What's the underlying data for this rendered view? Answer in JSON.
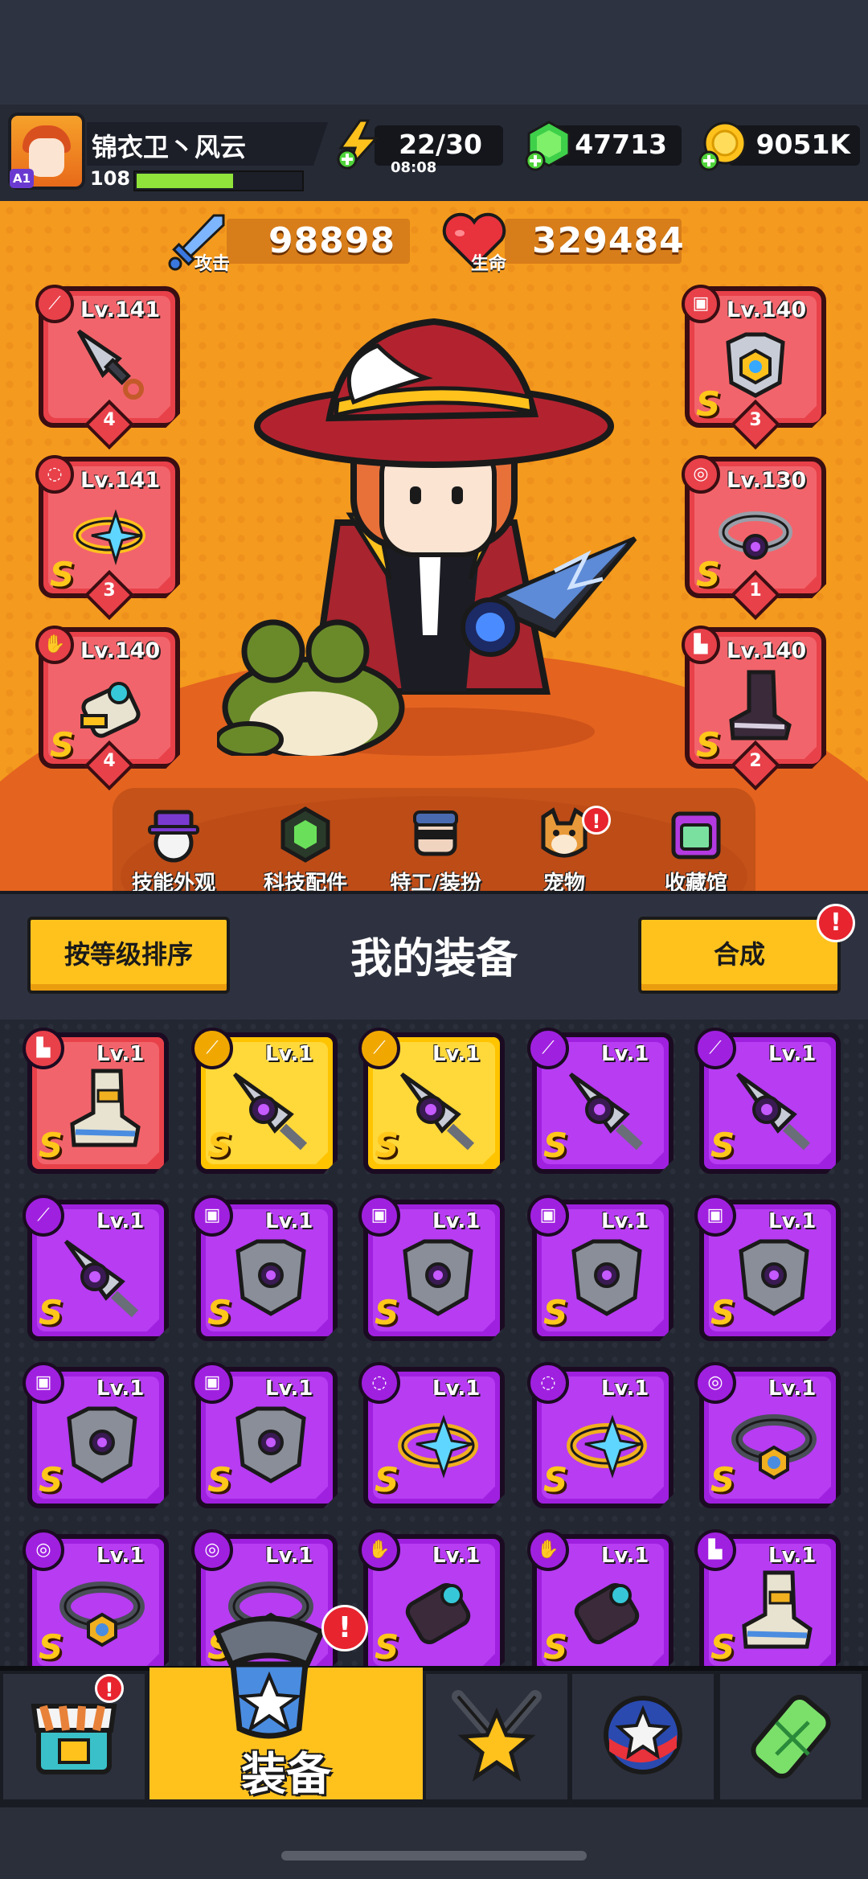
{
  "player": {
    "name": "锦衣卫丶风云",
    "level": "108",
    "rank_badge": "A1",
    "xp_progress": 0.6
  },
  "resources": {
    "energy": "22/30",
    "energy_timer": "08:08",
    "gems": "47713",
    "gold": "9051K"
  },
  "stats": {
    "attack_label": "攻击",
    "attack_value": "98898",
    "hp_label": "生命",
    "hp_value": "329484"
  },
  "equipped": {
    "left": [
      {
        "level": "Lv.141",
        "slot": "weapon",
        "grade": "",
        "stars": "4"
      },
      {
        "level": "Lv.141",
        "slot": "ring",
        "grade": "S",
        "stars": "3"
      },
      {
        "level": "Lv.140",
        "slot": "gloves",
        "grade": "S",
        "stars": "4"
      }
    ],
    "right": [
      {
        "level": "Lv.140",
        "slot": "armor",
        "grade": "S",
        "stars": "3"
      },
      {
        "level": "Lv.130",
        "slot": "belt",
        "grade": "S",
        "stars": "1"
      },
      {
        "level": "Lv.140",
        "slot": "boots",
        "grade": "S",
        "stars": "2"
      }
    ]
  },
  "subnav": [
    {
      "label": "技能外观",
      "icon": "skill-skin-icon"
    },
    {
      "label": "科技配件",
      "icon": "tech-parts-icon"
    },
    {
      "label": "特工/装扮",
      "icon": "agent-outfit-icon"
    },
    {
      "label": "宠物",
      "icon": "pet-icon",
      "alert": "!"
    },
    {
      "label": "收藏馆",
      "icon": "collection-icon"
    }
  ],
  "toolbar": {
    "sort_label": "按等级排序",
    "title": "我的装备",
    "merge_label": "合成",
    "merge_alert": "!"
  },
  "inventory": [
    {
      "level": "Lv.1",
      "slot": "boots",
      "rarity": "red",
      "grade": "S"
    },
    {
      "level": "Lv.1",
      "slot": "weapon",
      "rarity": "gold",
      "grade": "S"
    },
    {
      "level": "Lv.1",
      "slot": "weapon",
      "rarity": "gold",
      "grade": "S"
    },
    {
      "level": "Lv.1",
      "slot": "weapon",
      "rarity": "purple",
      "grade": "S"
    },
    {
      "level": "Lv.1",
      "slot": "weapon",
      "rarity": "purple",
      "grade": "S"
    },
    {
      "level": "Lv.1",
      "slot": "weapon",
      "rarity": "purple",
      "grade": "S"
    },
    {
      "level": "Lv.1",
      "slot": "armor",
      "rarity": "purple",
      "grade": "S"
    },
    {
      "level": "Lv.1",
      "slot": "armor",
      "rarity": "purple",
      "grade": "S"
    },
    {
      "level": "Lv.1",
      "slot": "armor",
      "rarity": "purple",
      "grade": "S"
    },
    {
      "level": "Lv.1",
      "slot": "armor",
      "rarity": "purple",
      "grade": "S"
    },
    {
      "level": "Lv.1",
      "slot": "armor",
      "rarity": "purple",
      "grade": "S"
    },
    {
      "level": "Lv.1",
      "slot": "armor",
      "rarity": "purple",
      "grade": "S"
    },
    {
      "level": "Lv.1",
      "slot": "ring",
      "rarity": "purple",
      "grade": "S"
    },
    {
      "level": "Lv.1",
      "slot": "ring",
      "rarity": "purple",
      "grade": "S"
    },
    {
      "level": "Lv.1",
      "slot": "belt",
      "rarity": "purple",
      "grade": "S"
    },
    {
      "level": "Lv.1",
      "slot": "belt",
      "rarity": "purple",
      "grade": "S"
    },
    {
      "level": "Lv.1",
      "slot": "belt",
      "rarity": "purple",
      "grade": "S"
    },
    {
      "level": "Lv.1",
      "slot": "gloves",
      "rarity": "purple",
      "grade": "S"
    },
    {
      "level": "Lv.1",
      "slot": "gloves",
      "rarity": "purple",
      "grade": "S"
    },
    {
      "level": "Lv.1",
      "slot": "boots",
      "rarity": "purple",
      "grade": "S"
    }
  ],
  "bottom_nav": [
    {
      "name": "shop-tab",
      "icon": "shop-icon",
      "alert": "!"
    },
    {
      "name": "equipment-tab",
      "icon": "equipment-icon",
      "label": "装备",
      "alert": "!",
      "active": true
    },
    {
      "name": "battle-tab",
      "icon": "crossed-swords-icon"
    },
    {
      "name": "events-tab",
      "icon": "star-orb-icon"
    },
    {
      "name": "lab-tab",
      "icon": "dna-capsule-icon"
    }
  ],
  "colors": {
    "stage": "#f49a1e",
    "accent_yellow": "#ffc21d",
    "alert_red": "#e8242f",
    "rarity_purple": "#a020e0",
    "rarity_red": "#e8414a",
    "rarity_gold": "#ffc400",
    "xp_green": "#8fe33a"
  }
}
